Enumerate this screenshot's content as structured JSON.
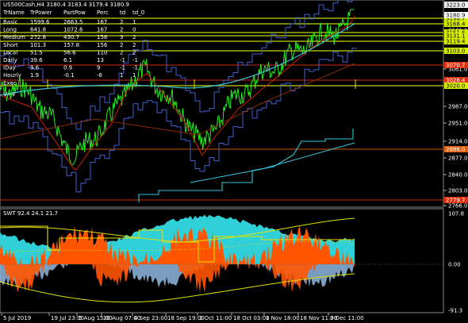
{
  "main_header": "US500Cash,H4  3180.4 3183.4 3179.4 3180.9",
  "table": {
    "headers": [
      "TrName",
      "TrPower",
      "PartPow",
      "Perc",
      "td",
      "td_0"
    ],
    "rows": [
      [
        "Basic",
        "1599.6",
        "2663.5",
        "167",
        "2",
        "1"
      ],
      [
        "Long",
        "641.8",
        "1072.6",
        "167",
        "2",
        "0"
      ],
      [
        "Medium",
        "272.8",
        "430.7",
        "158",
        "3",
        "2"
      ],
      [
        "Short",
        "101.3",
        "157.8",
        "156",
        "2",
        "2"
      ],
      [
        "Local",
        "51.5",
        "56.6",
        "110",
        "2",
        "2"
      ],
      [
        "Daily",
        "39.6",
        "6.1",
        "13",
        "-1",
        "-1"
      ],
      [
        "IDay",
        "9.6",
        "0.9",
        "9",
        "-1",
        "-1"
      ],
      [
        "Hourly",
        "1.9",
        "-0.1",
        "-6",
        "1",
        "1"
      ],
      [
        "Exec",
        "",
        "",
        "",
        "",
        ""
      ]
    ]
  },
  "v_label": "V=4",
  "price_scale": [
    "3180.9",
    "3158.6",
    "3141.1",
    "3119.4",
    "3103.0",
    "3061.0",
    "3026.0",
    "2987.0",
    "2951.0",
    "2914.0",
    "2877.0",
    "2840.0",
    "2803.0",
    "2766.0"
  ],
  "price_tags": [
    {
      "text": "3223.0",
      "color": "#f0f0f0"
    },
    {
      "text": "3196.7",
      "color": "#d8f000"
    },
    {
      "text": "3180.9",
      "color": "#ffffff"
    },
    {
      "text": "3168.4",
      "color": "#d8f000"
    },
    {
      "text": "3151.6",
      "color": "#d8f000"
    },
    {
      "text": "3131.1",
      "color": "#d8f000"
    },
    {
      "text": "3119.4",
      "color": "#d8f000"
    },
    {
      "text": "3103.0",
      "color": "#d8f000"
    },
    {
      "text": "3070.7",
      "color": "#e03010"
    },
    {
      "text": "3026.4",
      "color": "#e03010"
    },
    {
      "text": "3020.0",
      "color": "#d8f000"
    },
    {
      "text": "2886.0",
      "color": "#e06010"
    },
    {
      "text": "2779.7",
      "color": "#e03010"
    }
  ],
  "sub_header": "SWT 92.4 24.1 21.7",
  "sub_scale": [
    "107.8",
    "0.00",
    "-91.3"
  ],
  "time_axis": [
    "5 Jul 2019",
    "19 Jul 23:00",
    "5 Aug 15:00",
    "20 Aug 07:00",
    "4 Sep 23:00",
    "18 Sep 19:00",
    "3 Oct 11:00",
    "18 Oct 03:00",
    "1 Nov 18:00",
    "18 Nov 11:00",
    "3 Dec 11:00"
  ],
  "colors": {
    "price": "#22ee22",
    "trend_cyan": "#33c6dd",
    "trend_blue": "#3f5fcf",
    "trend_red": "#cc2200",
    "trend_yellow": "#e0e000",
    "osc_cyan": "#2fd0d8",
    "osc_orange": "#ff5500",
    "osc_lightblue": "#8fb8e0"
  }
}
